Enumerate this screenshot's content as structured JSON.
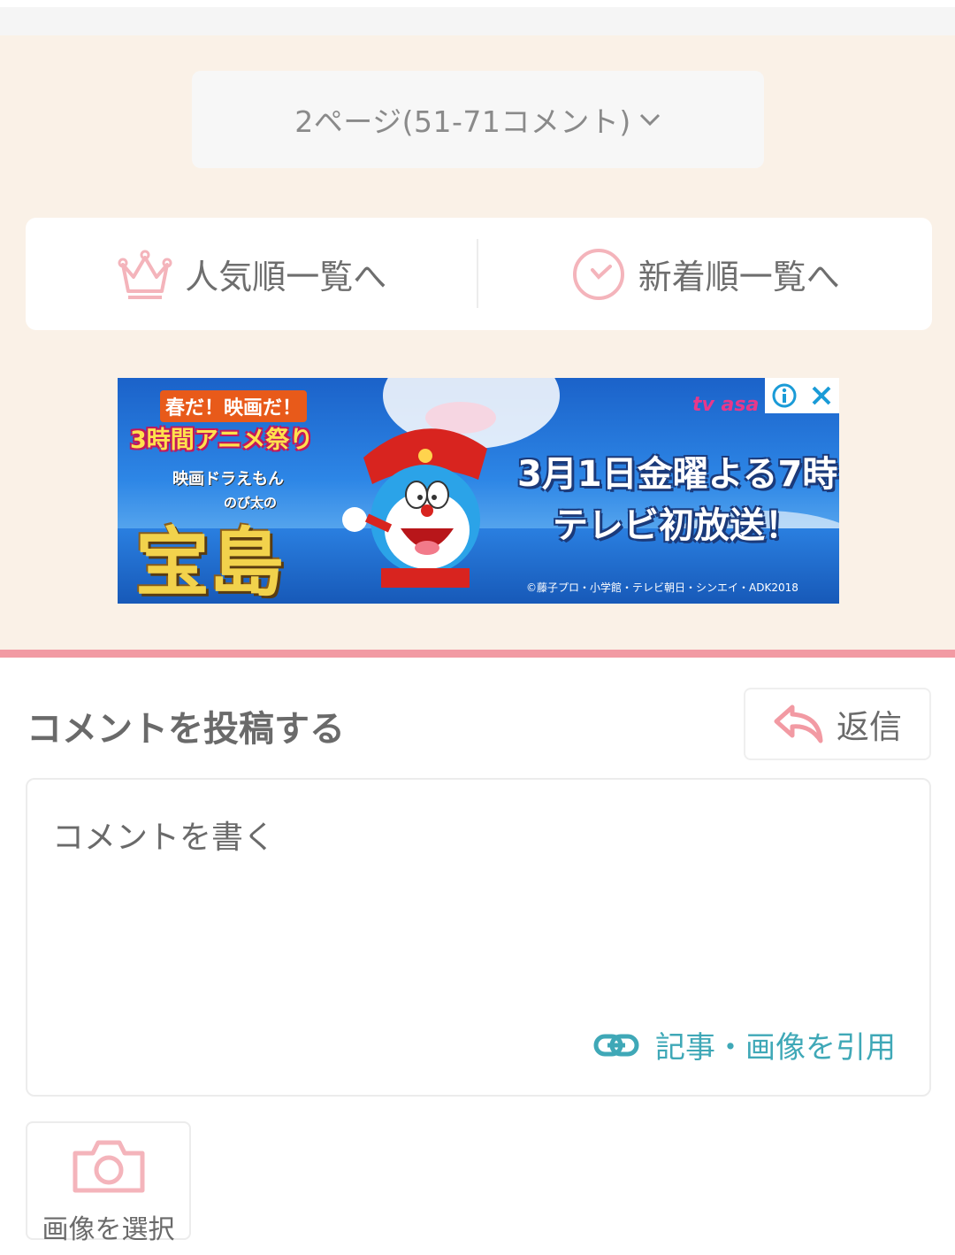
{
  "pagination": {
    "selected_label": "2ページ(51-71コメント)"
  },
  "ranking_nav": {
    "popular_label": "人気順一覧へ",
    "newest_label": "新着順一覧へ"
  },
  "ad": {
    "top_tag": "春だ！映画だ！",
    "festival": "3時間アニメ祭り",
    "subtitle": "映画ドラえもん",
    "subtitle2": "のび太の",
    "title": "宝島",
    "broadcaster": "tv asa",
    "line1": "3月1日金曜よる7時",
    "line2": "テレビ初放送！",
    "copyright": "©藤子プロ・小学館・テレビ朝日・シンエイ・ADK2018"
  },
  "comment_form": {
    "title": "コメントを投稿する",
    "reply_label": "返信",
    "placeholder": "コメントを書く",
    "quote_label": "記事・画像を引用",
    "image_select_label": "画像を選択"
  },
  "colors": {
    "beige_bg": "#faf1e7",
    "accent_pink": "#f29aa3",
    "icon_pink": "#f4b4bb",
    "link_teal": "#3fa8b7"
  }
}
